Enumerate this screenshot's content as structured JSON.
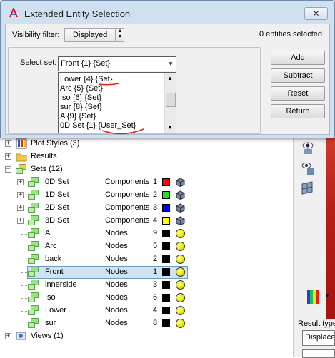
{
  "dialog": {
    "title": "Extended Entity Selection",
    "close_glyph": "✕",
    "visibility_filter_label": "Visibility filter:",
    "visibility_filter_value": "Displayed",
    "entities_selected": "0 entities selected",
    "select_set_label": "Select set:",
    "select_set_value": "Front {1} {Set}",
    "set_options": [
      "Lower {4} {Set}",
      "Arc {5} {Set}",
      "Iso {6} {Set}",
      "sur {8} {Set}",
      "A {9} {Set}",
      "0D Set {1} {User_Set}"
    ],
    "buttons": {
      "add": "Add",
      "subtract": "Subtract",
      "reset": "Reset",
      "return": "Return"
    },
    "annotation_color": "#e0201a"
  },
  "tree": {
    "plot_styles": "Plot Styles (3)",
    "results": "Results",
    "sets": "Sets (12)",
    "views": "Views (1)",
    "set_rows": [
      {
        "name": "0D Set",
        "type": "Components",
        "id": "1",
        "color": "#ff0000",
        "icon": "cube-icon"
      },
      {
        "name": "1D Set",
        "type": "Components",
        "id": "2",
        "color": "#22dd22",
        "icon": "cube-icon"
      },
      {
        "name": "2D Set",
        "type": "Components",
        "id": "3",
        "color": "#0000ff",
        "icon": "cube-icon"
      },
      {
        "name": "3D Set",
        "type": "Components",
        "id": "4",
        "color": "#ffff00",
        "icon": "cube-icon"
      },
      {
        "name": "A",
        "type": "Nodes",
        "id": "9",
        "color": "#000000",
        "icon": "ball-icon"
      },
      {
        "name": "Arc",
        "type": "Nodes",
        "id": "5",
        "color": "#000000",
        "icon": "ball-icon"
      },
      {
        "name": "back",
        "type": "Nodes",
        "id": "2",
        "color": "#000000",
        "icon": "ball-icon"
      },
      {
        "name": "Front",
        "type": "Nodes",
        "id": "1",
        "color": "#000000",
        "icon": "ball-icon",
        "selected": true
      },
      {
        "name": "innerside",
        "type": "Nodes",
        "id": "3",
        "color": "#000000",
        "icon": "ball-icon"
      },
      {
        "name": "Iso",
        "type": "Nodes",
        "id": "6",
        "color": "#000000",
        "icon": "ball-icon"
      },
      {
        "name": "Lower",
        "type": "Nodes",
        "id": "4",
        "color": "#000000",
        "icon": "ball-icon"
      },
      {
        "name": "sur",
        "type": "Nodes",
        "id": "8",
        "color": "#000000",
        "icon": "ball-icon"
      }
    ]
  },
  "right_panel": {
    "result_type_label": "Result type",
    "result_type_value": "Displace"
  }
}
